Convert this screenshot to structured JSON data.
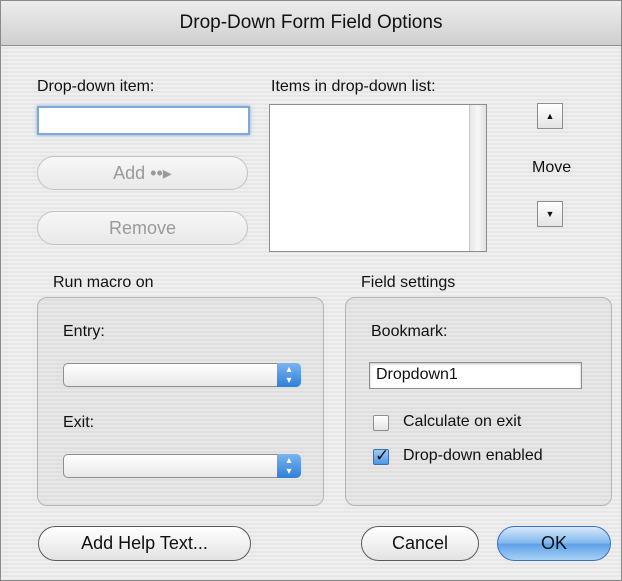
{
  "window": {
    "title": "Drop-Down Form Field Options"
  },
  "dropdown_item": {
    "label": "Drop-down item:",
    "value": ""
  },
  "buttons": {
    "add": "Add ••▸",
    "remove": "Remove",
    "add_help_text": "Add Help Text...",
    "cancel": "Cancel",
    "ok": "OK"
  },
  "items_list": {
    "label": "Items in drop-down list:",
    "items": []
  },
  "move": {
    "label": "Move",
    "up_icon": "triangle-up",
    "down_icon": "triangle-down"
  },
  "run_macro": {
    "title": "Run macro on",
    "entry_label": "Entry:",
    "entry_value": "",
    "exit_label": "Exit:",
    "exit_value": ""
  },
  "field_settings": {
    "title": "Field settings",
    "bookmark_label": "Bookmark:",
    "bookmark_value": "Dropdown1",
    "calculate_on_exit": {
      "label": "Calculate on exit",
      "checked": false
    },
    "dropdown_enabled": {
      "label": "Drop-down enabled",
      "checked": true
    }
  },
  "colors": {
    "default_button": "#5ba0e8",
    "focus_ring": "#7fa6dd"
  }
}
